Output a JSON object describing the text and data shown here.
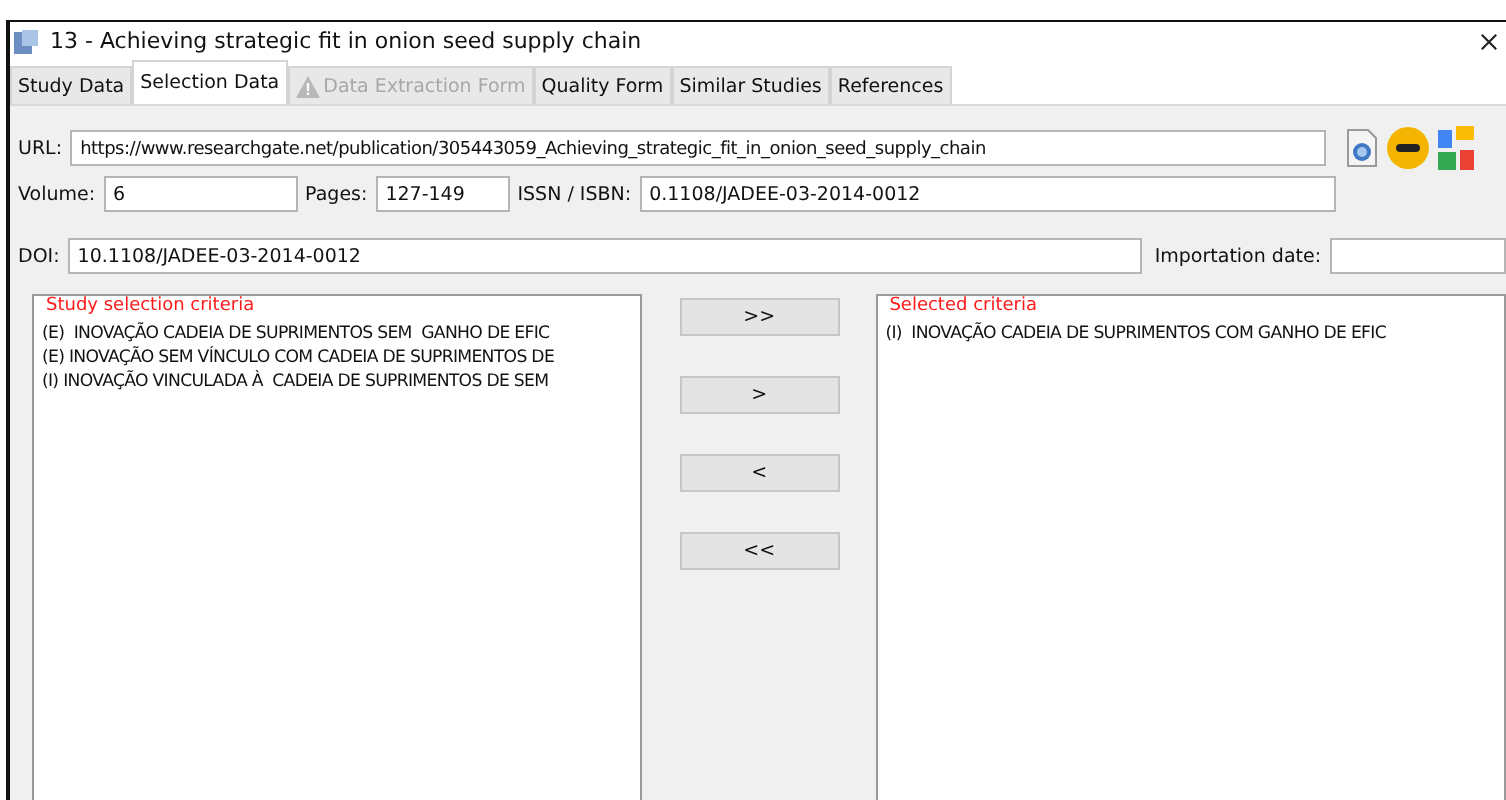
{
  "window": {
    "title": "13 - Achieving strategic fit in onion seed supply chain"
  },
  "tabs": [
    {
      "label": "Study Data",
      "selected": false,
      "disabled": false
    },
    {
      "label": "Selection Data",
      "selected": true,
      "disabled": false
    },
    {
      "label": "Data Extraction Form",
      "selected": false,
      "disabled": true
    },
    {
      "label": "Quality Form",
      "selected": false,
      "disabled": false
    },
    {
      "label": "Similar Studies",
      "selected": false,
      "disabled": false
    },
    {
      "label": "References",
      "selected": false,
      "disabled": false
    }
  ],
  "form": {
    "url_label": "URL:",
    "url": "https://www.researchgate.net/publication/305443059_Achieving_strategic_fit_in_onion_seed_supply_chain",
    "volume_label": "Volume:",
    "volume": "6",
    "pages_label": "Pages:",
    "pages": "127-149",
    "issn_label": "ISSN / ISBN:",
    "issn": "0.1108/JADEE-03-2014-0012",
    "doi_label": "DOI:",
    "doi": "10.1108/JADEE-03-2014-0012",
    "importation_label": "Importation date:"
  },
  "study_selection": {
    "title": "Study selection criteria",
    "items": [
      "(E)  INOVAÇÃO CADEIA DE SUPRIMENTOS SEM  GANHO DE EFIC",
      "(E) INOVAÇÃO SEM VÍNCULO COM CADEIA DE SUPRIMENTOS DE",
      "(I) INOVAÇÃO VINCULADA À  CADEIA DE SUPRIMENTOS DE SEM"
    ]
  },
  "move_buttons": [
    ">>",
    ">",
    "<",
    "<<"
  ],
  "selected_criteria": {
    "title": "Selected criteria",
    "items": [
      "(I)  INOVAÇÃO CADEIA DE SUPRIMENTOS COM GANHO DE EFIC"
    ]
  }
}
